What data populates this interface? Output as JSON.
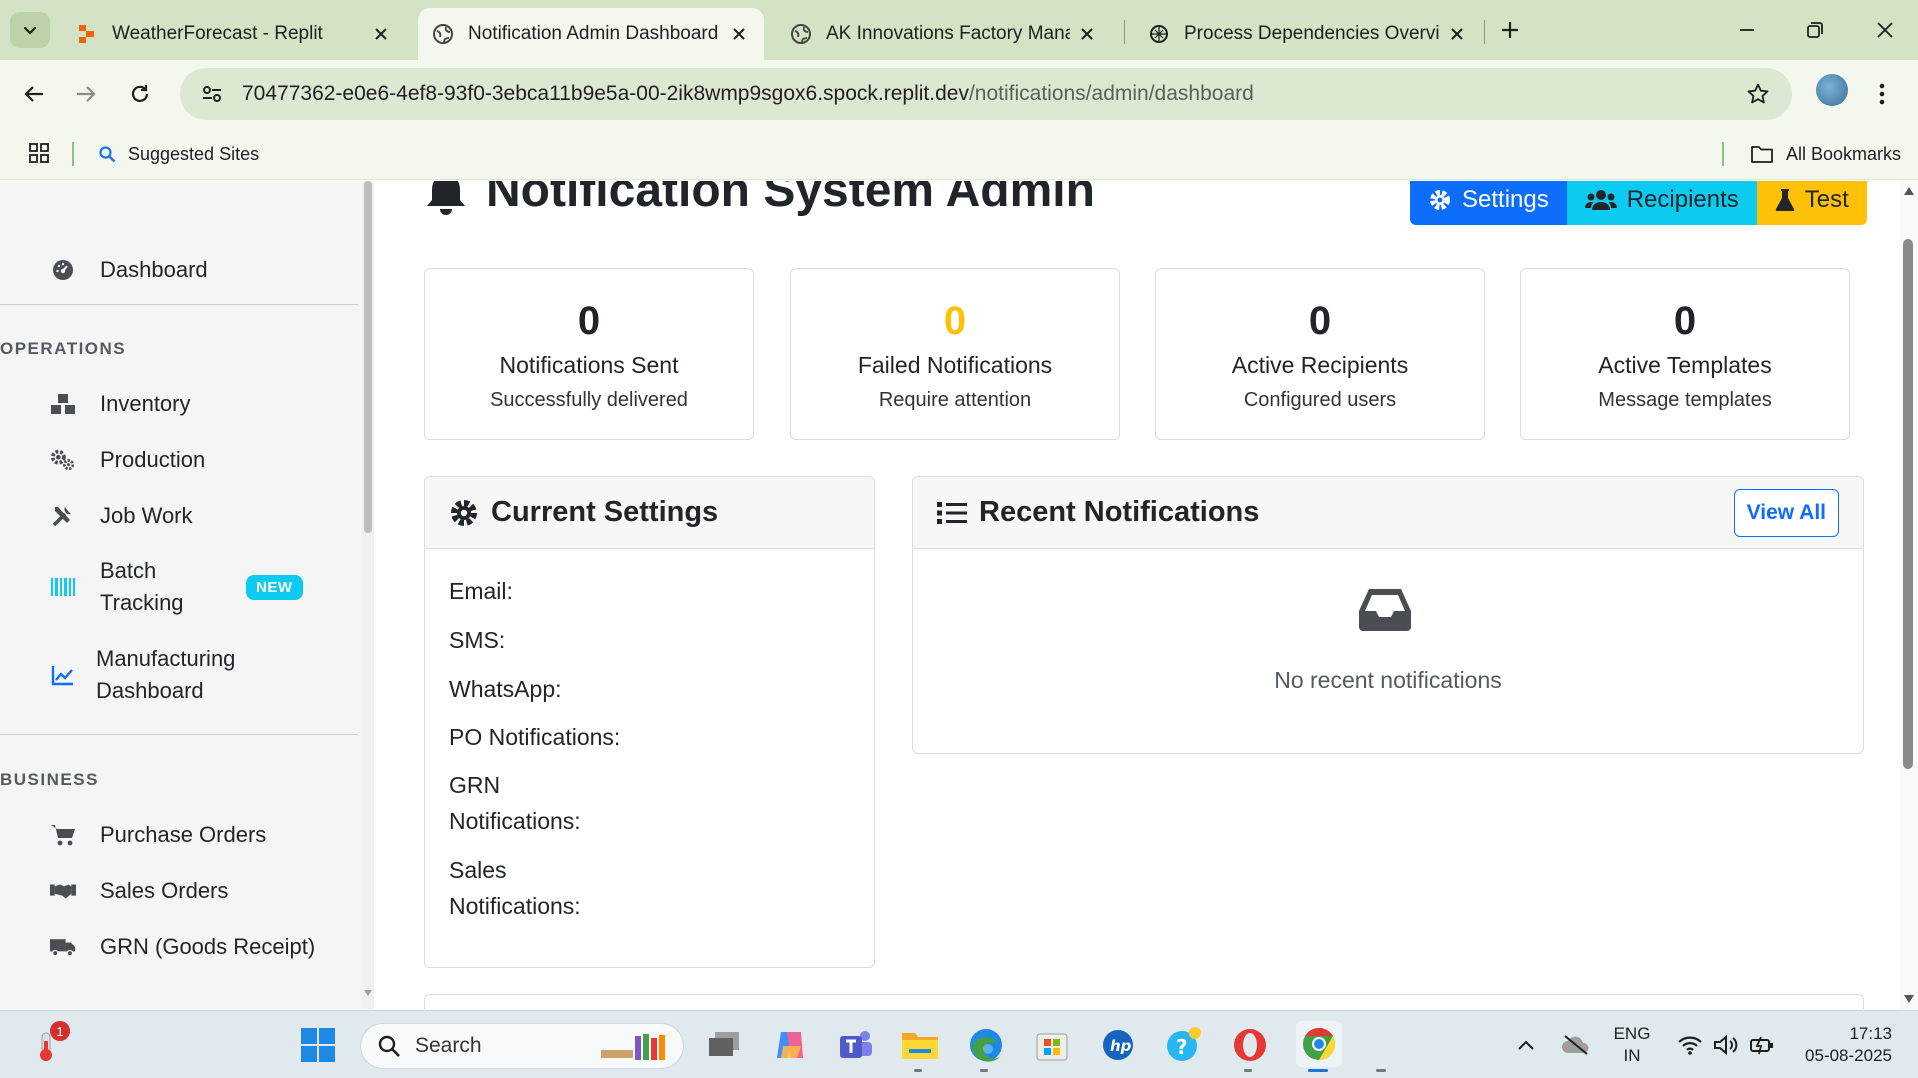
{
  "browser": {
    "tabs": [
      {
        "title": "WeatherForecast - Replit",
        "active": false
      },
      {
        "title": "Notification Admin Dashboard",
        "active": true
      },
      {
        "title": "AK Innovations Factory Manage",
        "active": false
      },
      {
        "title": "Process Dependencies Overview",
        "active": false
      }
    ],
    "url_host": "70477362-e0e6-4ef8-93f0-3ebca11b9e5a-00-2ik8wmp9sgox6.spock.replit.dev",
    "url_path": "/notifications/admin/dashboard",
    "bookmarks": {
      "suggested": "Suggested Sites",
      "all": "All Bookmarks"
    }
  },
  "sidebar": {
    "dashboard": "Dashboard",
    "operations_heading": "OPERATIONS",
    "operations": [
      {
        "label": "Inventory",
        "icon": "boxes-icon"
      },
      {
        "label": "Production",
        "icon": "cogs-icon"
      },
      {
        "label": "Job Work",
        "icon": "tools-icon"
      },
      {
        "label_line1": "Batch",
        "label_line2": "Tracking",
        "badge": "NEW",
        "icon": "barcode-icon"
      },
      {
        "label_line1": "Manufacturing",
        "label_line2": "Dashboard",
        "icon": "chart-line-icon"
      }
    ],
    "business_heading": "BUSINESS",
    "business": [
      {
        "label": "Purchase Orders",
        "icon": "cart-icon"
      },
      {
        "label": "Sales Orders",
        "icon": "handshake-icon"
      },
      {
        "label": "GRN (Goods Receipt)",
        "icon": "truck-icon"
      }
    ]
  },
  "header": {
    "title": "Notification System Admin",
    "buttons": {
      "settings": "Settings",
      "recipients": "Recipients",
      "test": "Test"
    }
  },
  "stats": [
    {
      "value": "0",
      "label": "Notifications Sent",
      "sub": "Successfully delivered",
      "color": "#212529"
    },
    {
      "value": "0",
      "label": "Failed Notifications",
      "sub": "Require attention",
      "color": "#ffc107"
    },
    {
      "value": "0",
      "label": "Active Recipients",
      "sub": "Configured users",
      "color": "#212529"
    },
    {
      "value": "0",
      "label": "Active Templates",
      "sub": "Message templates",
      "color": "#212529"
    }
  ],
  "current_settings": {
    "title": "Current Settings",
    "rows": {
      "email": "Email:",
      "sms": "SMS:",
      "whatsapp": "WhatsApp:",
      "po": "PO Notifications:",
      "grn_line1": "GRN",
      "grn_line2": "Notifications:",
      "sales_line1": "Sales",
      "sales_line2": "Notifications:"
    }
  },
  "recent_notifications": {
    "title": "Recent Notifications",
    "view_all": "View All",
    "empty_text": "No recent notifications"
  },
  "taskbar": {
    "search_placeholder": "Search",
    "notification_count": "1",
    "lang_line1": "ENG",
    "lang_line2": "IN",
    "time": "17:13",
    "date": "05-08-2025"
  },
  "colors": {
    "primary": "#0d6efd",
    "info": "#0dcaf0",
    "warning": "#ffc107",
    "chrome_tabbar": "#d3e3c4"
  }
}
